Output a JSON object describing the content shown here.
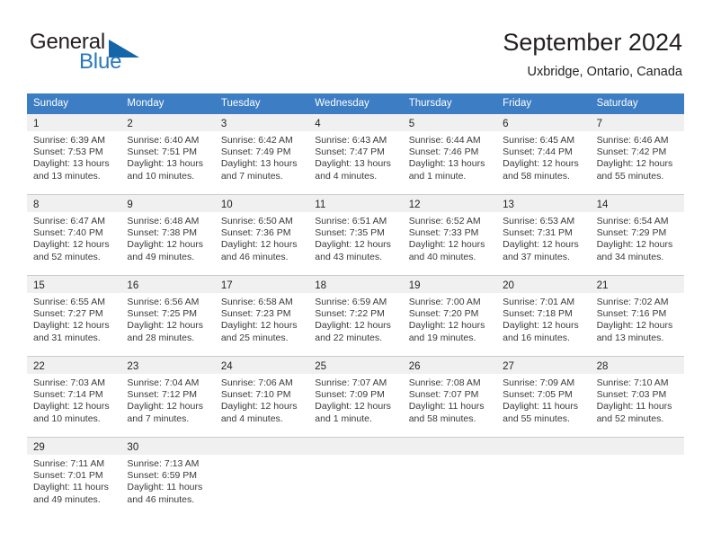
{
  "brand": {
    "word_general": "General",
    "word_blue": "Blue",
    "triangle_color": "#1466a8",
    "blue_text_color": "#2878be"
  },
  "header": {
    "title": "September 2024",
    "subtitle": "Uxbridge, Ontario, Canada",
    "accent_color": "#3c7dc4",
    "band_color": "#f0f0f0"
  },
  "weekday_headers": [
    "Sunday",
    "Monday",
    "Tuesday",
    "Wednesday",
    "Thursday",
    "Friday",
    "Saturday"
  ],
  "weeks": [
    {
      "days": [
        {
          "date": "1",
          "sunrise": "Sunrise: 6:39 AM",
          "sunset": "Sunset: 7:53 PM",
          "daylight_line1": "Daylight: 13 hours",
          "daylight_line2": "and 13 minutes."
        },
        {
          "date": "2",
          "sunrise": "Sunrise: 6:40 AM",
          "sunset": "Sunset: 7:51 PM",
          "daylight_line1": "Daylight: 13 hours",
          "daylight_line2": "and 10 minutes."
        },
        {
          "date": "3",
          "sunrise": "Sunrise: 6:42 AM",
          "sunset": "Sunset: 7:49 PM",
          "daylight_line1": "Daylight: 13 hours",
          "daylight_line2": "and 7 minutes."
        },
        {
          "date": "4",
          "sunrise": "Sunrise: 6:43 AM",
          "sunset": "Sunset: 7:47 PM",
          "daylight_line1": "Daylight: 13 hours",
          "daylight_line2": "and 4 minutes."
        },
        {
          "date": "5",
          "sunrise": "Sunrise: 6:44 AM",
          "sunset": "Sunset: 7:46 PM",
          "daylight_line1": "Daylight: 13 hours",
          "daylight_line2": "and 1 minute."
        },
        {
          "date": "6",
          "sunrise": "Sunrise: 6:45 AM",
          "sunset": "Sunset: 7:44 PM",
          "daylight_line1": "Daylight: 12 hours",
          "daylight_line2": "and 58 minutes."
        },
        {
          "date": "7",
          "sunrise": "Sunrise: 6:46 AM",
          "sunset": "Sunset: 7:42 PM",
          "daylight_line1": "Daylight: 12 hours",
          "daylight_line2": "and 55 minutes."
        }
      ]
    },
    {
      "days": [
        {
          "date": "8",
          "sunrise": "Sunrise: 6:47 AM",
          "sunset": "Sunset: 7:40 PM",
          "daylight_line1": "Daylight: 12 hours",
          "daylight_line2": "and 52 minutes."
        },
        {
          "date": "9",
          "sunrise": "Sunrise: 6:48 AM",
          "sunset": "Sunset: 7:38 PM",
          "daylight_line1": "Daylight: 12 hours",
          "daylight_line2": "and 49 minutes."
        },
        {
          "date": "10",
          "sunrise": "Sunrise: 6:50 AM",
          "sunset": "Sunset: 7:36 PM",
          "daylight_line1": "Daylight: 12 hours",
          "daylight_line2": "and 46 minutes."
        },
        {
          "date": "11",
          "sunrise": "Sunrise: 6:51 AM",
          "sunset": "Sunset: 7:35 PM",
          "daylight_line1": "Daylight: 12 hours",
          "daylight_line2": "and 43 minutes."
        },
        {
          "date": "12",
          "sunrise": "Sunrise: 6:52 AM",
          "sunset": "Sunset: 7:33 PM",
          "daylight_line1": "Daylight: 12 hours",
          "daylight_line2": "and 40 minutes."
        },
        {
          "date": "13",
          "sunrise": "Sunrise: 6:53 AM",
          "sunset": "Sunset: 7:31 PM",
          "daylight_line1": "Daylight: 12 hours",
          "daylight_line2": "and 37 minutes."
        },
        {
          "date": "14",
          "sunrise": "Sunrise: 6:54 AM",
          "sunset": "Sunset: 7:29 PM",
          "daylight_line1": "Daylight: 12 hours",
          "daylight_line2": "and 34 minutes."
        }
      ]
    },
    {
      "days": [
        {
          "date": "15",
          "sunrise": "Sunrise: 6:55 AM",
          "sunset": "Sunset: 7:27 PM",
          "daylight_line1": "Daylight: 12 hours",
          "daylight_line2": "and 31 minutes."
        },
        {
          "date": "16",
          "sunrise": "Sunrise: 6:56 AM",
          "sunset": "Sunset: 7:25 PM",
          "daylight_line1": "Daylight: 12 hours",
          "daylight_line2": "and 28 minutes."
        },
        {
          "date": "17",
          "sunrise": "Sunrise: 6:58 AM",
          "sunset": "Sunset: 7:23 PM",
          "daylight_line1": "Daylight: 12 hours",
          "daylight_line2": "and 25 minutes."
        },
        {
          "date": "18",
          "sunrise": "Sunrise: 6:59 AM",
          "sunset": "Sunset: 7:22 PM",
          "daylight_line1": "Daylight: 12 hours",
          "daylight_line2": "and 22 minutes."
        },
        {
          "date": "19",
          "sunrise": "Sunrise: 7:00 AM",
          "sunset": "Sunset: 7:20 PM",
          "daylight_line1": "Daylight: 12 hours",
          "daylight_line2": "and 19 minutes."
        },
        {
          "date": "20",
          "sunrise": "Sunrise: 7:01 AM",
          "sunset": "Sunset: 7:18 PM",
          "daylight_line1": "Daylight: 12 hours",
          "daylight_line2": "and 16 minutes."
        },
        {
          "date": "21",
          "sunrise": "Sunrise: 7:02 AM",
          "sunset": "Sunset: 7:16 PM",
          "daylight_line1": "Daylight: 12 hours",
          "daylight_line2": "and 13 minutes."
        }
      ]
    },
    {
      "days": [
        {
          "date": "22",
          "sunrise": "Sunrise: 7:03 AM",
          "sunset": "Sunset: 7:14 PM",
          "daylight_line1": "Daylight: 12 hours",
          "daylight_line2": "and 10 minutes."
        },
        {
          "date": "23",
          "sunrise": "Sunrise: 7:04 AM",
          "sunset": "Sunset: 7:12 PM",
          "daylight_line1": "Daylight: 12 hours",
          "daylight_line2": "and 7 minutes."
        },
        {
          "date": "24",
          "sunrise": "Sunrise: 7:06 AM",
          "sunset": "Sunset: 7:10 PM",
          "daylight_line1": "Daylight: 12 hours",
          "daylight_line2": "and 4 minutes."
        },
        {
          "date": "25",
          "sunrise": "Sunrise: 7:07 AM",
          "sunset": "Sunset: 7:09 PM",
          "daylight_line1": "Daylight: 12 hours",
          "daylight_line2": "and 1 minute."
        },
        {
          "date": "26",
          "sunrise": "Sunrise: 7:08 AM",
          "sunset": "Sunset: 7:07 PM",
          "daylight_line1": "Daylight: 11 hours",
          "daylight_line2": "and 58 minutes."
        },
        {
          "date": "27",
          "sunrise": "Sunrise: 7:09 AM",
          "sunset": "Sunset: 7:05 PM",
          "daylight_line1": "Daylight: 11 hours",
          "daylight_line2": "and 55 minutes."
        },
        {
          "date": "28",
          "sunrise": "Sunrise: 7:10 AM",
          "sunset": "Sunset: 7:03 PM",
          "daylight_line1": "Daylight: 11 hours",
          "daylight_line2": "and 52 minutes."
        }
      ]
    },
    {
      "days": [
        {
          "date": "29",
          "sunrise": "Sunrise: 7:11 AM",
          "sunset": "Sunset: 7:01 PM",
          "daylight_line1": "Daylight: 11 hours",
          "daylight_line2": "and 49 minutes."
        },
        {
          "date": "30",
          "sunrise": "Sunrise: 7:13 AM",
          "sunset": "Sunset: 6:59 PM",
          "daylight_line1": "Daylight: 11 hours",
          "daylight_line2": "and 46 minutes."
        },
        {
          "date": "",
          "sunrise": "",
          "sunset": "",
          "daylight_line1": "",
          "daylight_line2": ""
        },
        {
          "date": "",
          "sunrise": "",
          "sunset": "",
          "daylight_line1": "",
          "daylight_line2": ""
        },
        {
          "date": "",
          "sunrise": "",
          "sunset": "",
          "daylight_line1": "",
          "daylight_line2": ""
        },
        {
          "date": "",
          "sunrise": "",
          "sunset": "",
          "daylight_line1": "",
          "daylight_line2": ""
        },
        {
          "date": "",
          "sunrise": "",
          "sunset": "",
          "daylight_line1": "",
          "daylight_line2": ""
        }
      ]
    }
  ]
}
